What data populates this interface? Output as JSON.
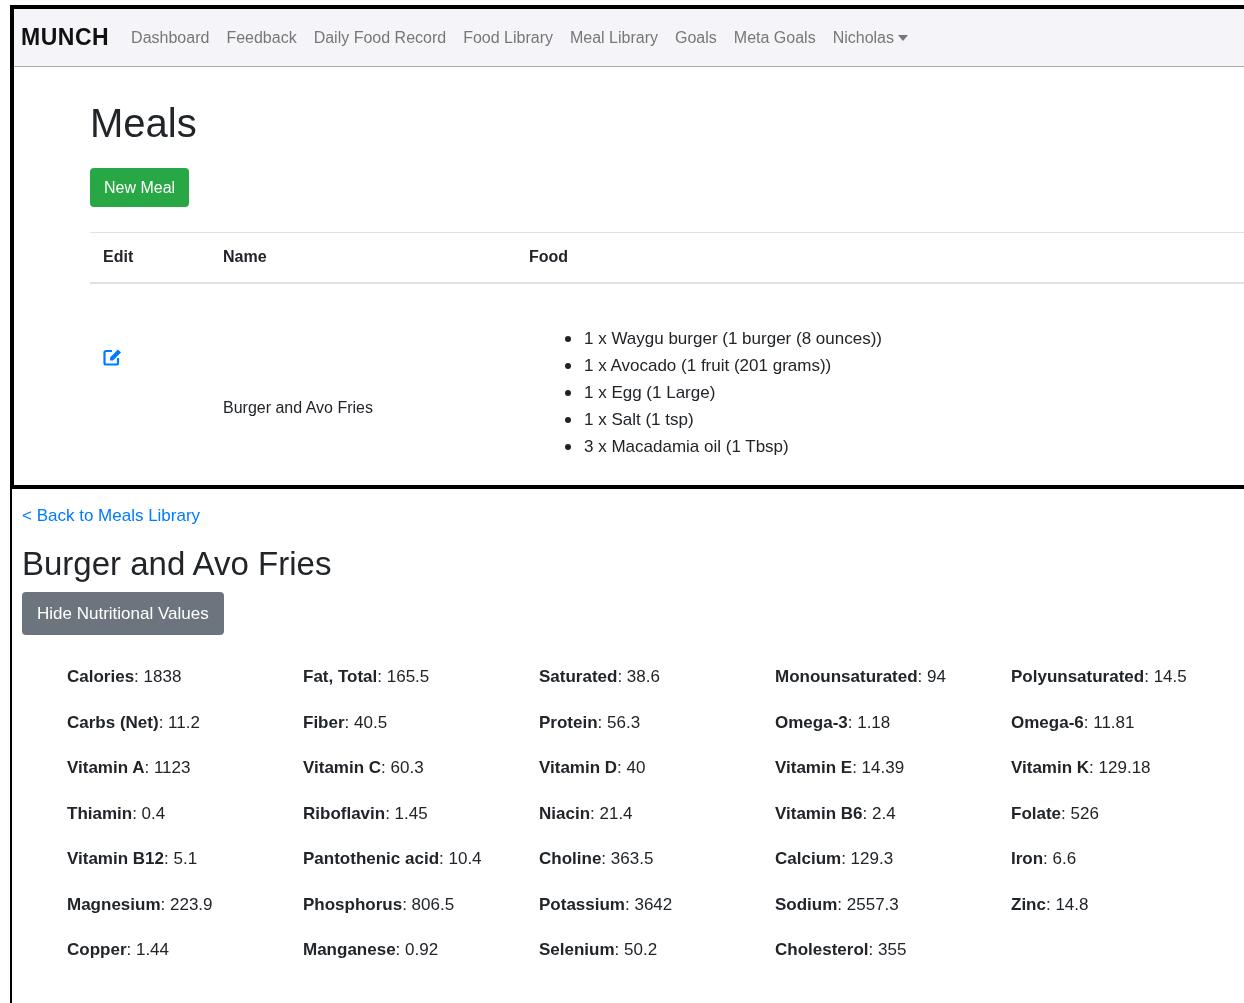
{
  "navbar": {
    "brand": "MUNCH",
    "items": [
      "Dashboard",
      "Feedback",
      "Daily Food Record",
      "Food Library",
      "Meal Library",
      "Goals",
      "Meta Goals"
    ],
    "user_menu": "Nicholas"
  },
  "meals_page": {
    "title": "Meals",
    "new_button": "New Meal",
    "table": {
      "columns": [
        "Edit",
        "Name",
        "Food"
      ],
      "rows": [
        {
          "name": "Burger and Avo Fries",
          "foods": [
            "1 x Waygu burger (1 burger (8 ounces))",
            "1 x Avocado (1 fruit (201 grams))",
            "1 x Egg (1 Large)",
            "1 x Salt (1 tsp)",
            "3 x Macadamia oil (1 Tbsp)"
          ]
        }
      ]
    }
  },
  "meal_detail": {
    "back_link": "< Back to Meals Library",
    "title": "Burger and Avo Fries",
    "toggle_button": "Hide Nutritional Values",
    "nutrients": [
      "**Calories**: 1838",
      "**Fat, Total**: 165.5",
      "**Saturated**: 38.6",
      "**Monounsaturated**: 94",
      "**Polyunsaturated**: 14.5",
      "**Carbs (Net)**: 11.2",
      "**Fiber**: 40.5",
      "**Protein**: 56.3",
      "**Omega-3**: 1.18",
      "**Omega-6**: 11.81",
      "**Vitamin A**: 1123",
      "**Vitamin C**: 60.3",
      "**Vitamin D**: 40",
      "**Vitamin E**: 14.39",
      "**Vitamin K**: 129.18",
      "**Thiamin**: 0.4",
      "**Riboflavin**: 1.45",
      "**Niacin**: 21.4",
      "**Vitamin B6**: 2.4",
      "**Folate**: 526",
      "**Vitamin B12**: 5.1",
      "**Pantothenic acid**: 10.4",
      "**Choline**: 363.5",
      "**Calcium**: 129.3",
      "**Iron**: 6.6",
      "**Magnesium**: 223.9",
      "**Phosphorus**: 806.5",
      "**Potassium**: 3642",
      "**Sodium**: 2557.3",
      "**Zinc**: 14.8",
      "**Copper**: 1.44",
      "**Manganese**: 0.92",
      "**Selenium**: 50.2",
      "**Cholesterol**: 355"
    ]
  }
}
